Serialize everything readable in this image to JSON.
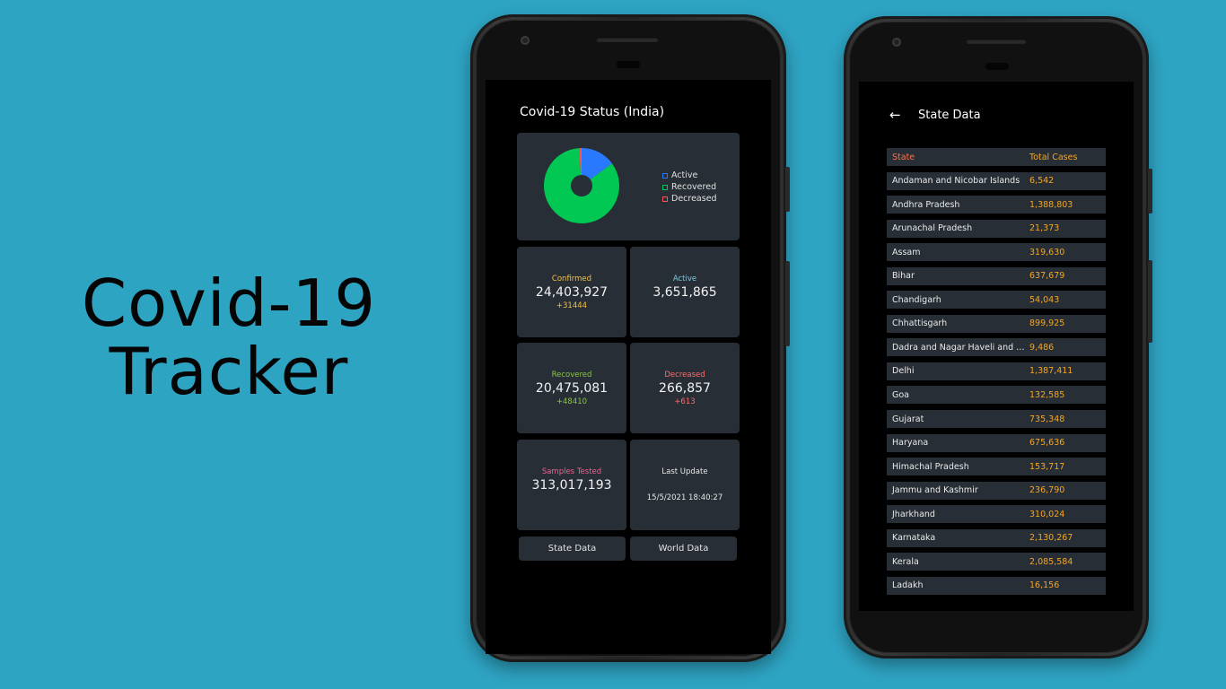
{
  "hero": {
    "line1": "Covid-19",
    "line2": "Tracker"
  },
  "colors": {
    "background": "#2ea4c3",
    "card": "#272e35",
    "active": "#2979ff",
    "recovered": "#00c853",
    "deceased": "#ff5252",
    "confirmed_label": "#f5c242",
    "active_label": "#7ecbe0",
    "recovered_label": "#8bc34a",
    "decreased_label": "#ff6b6b",
    "samples_label": "#f06292",
    "state_header": "#ff7043",
    "cases_text": "#f5a623"
  },
  "main_screen": {
    "title": "Covid-19 Status (India)",
    "legend": [
      "Active",
      "Recovered",
      "Decreased"
    ],
    "stats": {
      "confirmed": {
        "label": "Confirmed",
        "value": "24,403,927",
        "delta": "+31444"
      },
      "active": {
        "label": "Active",
        "value": "3,651,865"
      },
      "recovered": {
        "label": "Recovered",
        "value": "20,475,081",
        "delta": "+48410"
      },
      "decreased": {
        "label": "Decreased",
        "value": "266,857",
        "delta": "+613"
      },
      "samples": {
        "label": "Samples Tested",
        "value": "313,017,193"
      },
      "last_update": {
        "label": "Last Update",
        "value": "15/5/2021 18:40:27"
      }
    },
    "buttons": {
      "state_data": "State Data",
      "world_data": "World Data"
    }
  },
  "chart_data": {
    "type": "pie",
    "categories": [
      "Active",
      "Recovered",
      "Decreased"
    ],
    "values": [
      3651865,
      20475081,
      266857
    ]
  },
  "state_screen": {
    "back_icon": "arrow-left-icon",
    "title": "State Data",
    "columns": [
      "State",
      "Total Cases"
    ],
    "rows": [
      [
        "Andaman and Nicobar Islands",
        "6,542"
      ],
      [
        "Andhra Pradesh",
        "1,388,803"
      ],
      [
        "Arunachal Pradesh",
        "21,373"
      ],
      [
        "Assam",
        "319,630"
      ],
      [
        "Bihar",
        "637,679"
      ],
      [
        "Chandigarh",
        "54,043"
      ],
      [
        "Chhattisgarh",
        "899,925"
      ],
      [
        "Dadra and Nagar Haveli and Dama...",
        "9,486"
      ],
      [
        "Delhi",
        "1,387,411"
      ],
      [
        "Goa",
        "132,585"
      ],
      [
        "Gujarat",
        "735,348"
      ],
      [
        "Haryana",
        "675,636"
      ],
      [
        "Himachal Pradesh",
        "153,717"
      ],
      [
        "Jammu and Kashmir",
        "236,790"
      ],
      [
        "Jharkhand",
        "310,024"
      ],
      [
        "Karnataka",
        "2,130,267"
      ],
      [
        "Kerala",
        "2,085,584"
      ],
      [
        "Ladakh",
        "16,156"
      ]
    ]
  }
}
